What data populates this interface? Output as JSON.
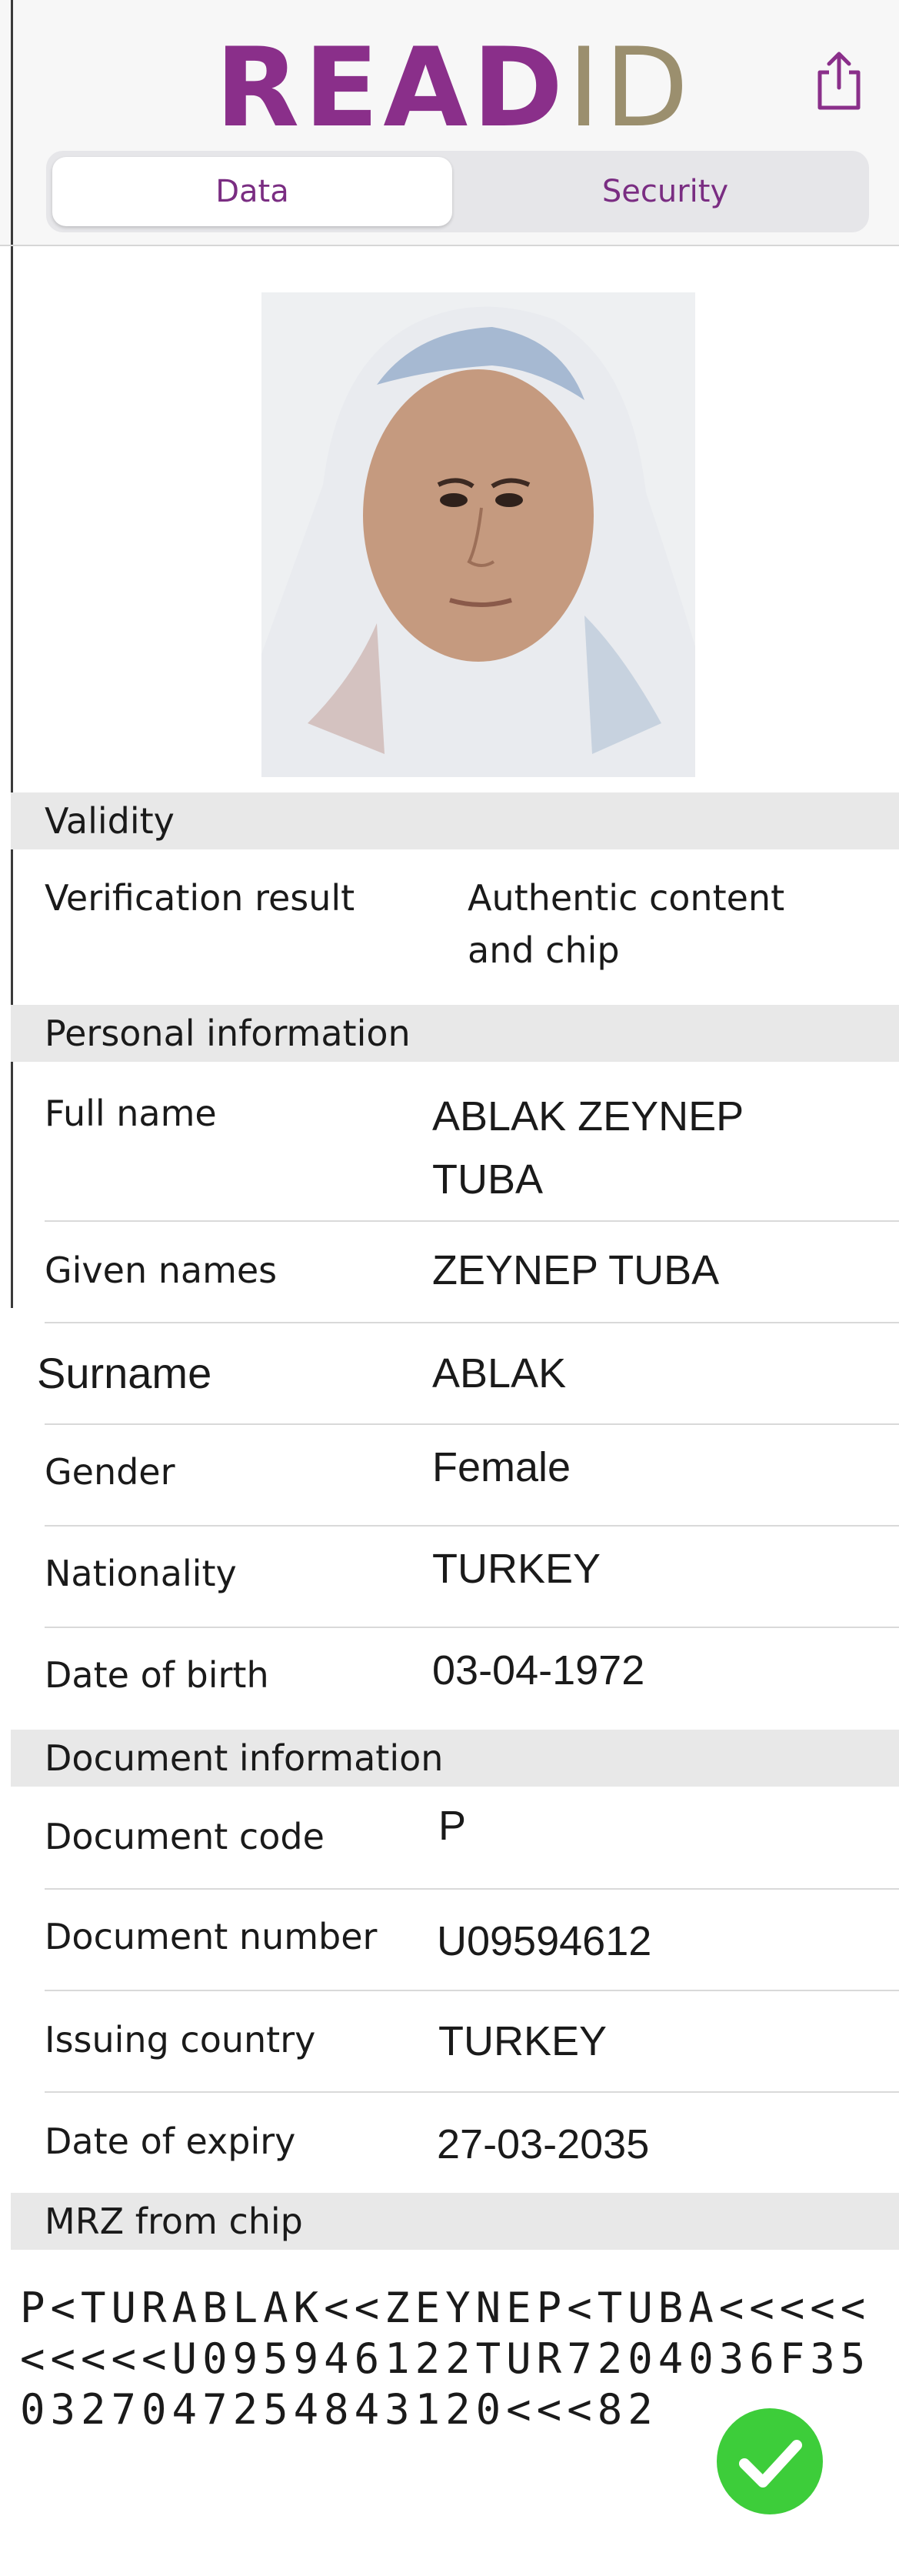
{
  "app": {
    "logo_part1": "READ",
    "logo_part2": "ID"
  },
  "tabs": {
    "data": "Data",
    "security": "Security"
  },
  "validity": {
    "header": "Validity",
    "verification_label": "Verification result",
    "verification_value_line1": "Authentic content",
    "verification_value_line2": "and chip"
  },
  "personal": {
    "header": "Personal information",
    "full_name_label": "Full name",
    "full_name_line1": "ABLAK ZEYNEP",
    "full_name_line2": "TUBA",
    "given_label": "Given names",
    "given_value": "ZEYNEP TUBA",
    "surname_label": "Surname",
    "surname_value": "ABLAK",
    "gender_label": "Gender",
    "gender_value": "Female",
    "nationality_label": "Nationality",
    "nationality_value": "TURKEY",
    "dob_label": "Date of birth",
    "dob_value": "03-04-1972"
  },
  "document": {
    "header": "Document information",
    "code_label": "Document code",
    "code_value": "P",
    "number_label": "Document number",
    "number_value": "U09594612",
    "country_label": "Issuing country",
    "country_value": "TURKEY",
    "expiry_label": "Date of expiry",
    "expiry_value": "27-03-2035"
  },
  "mrz": {
    "header": "MRZ from chip",
    "line1": "P<TURABLAK<<ZEYNEP<TUBA<<<<<",
    "line2": "<<<<<U095946122TUR7204036F35",
    "line3": "0327047254843120<<<82"
  },
  "colors": {
    "brand_purple": "#8a2f8a",
    "brand_gold": "#9b8f6e",
    "check_green": "#3dcd3a"
  },
  "icons": {
    "share": "share-icon",
    "check": "checkmark-circle-icon",
    "photo": "portrait-photo"
  }
}
